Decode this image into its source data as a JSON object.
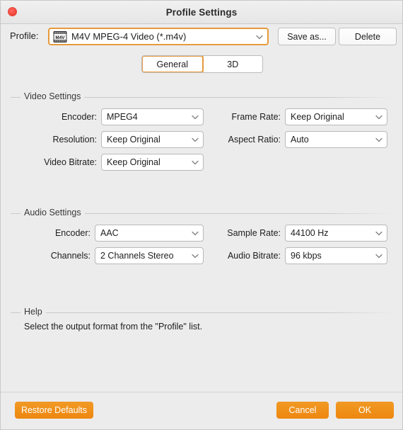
{
  "window": {
    "title": "Profile Settings",
    "close_icon": "close-traffic-light-icon",
    "accent_orange": "#ee8a14",
    "focus_orange": "#e79a3c",
    "background": "#ececec"
  },
  "profile": {
    "label": "Profile:",
    "icon": "m4v-film-strip-icon",
    "icon_text": "M4V",
    "value": "M4V MPEG-4 Video (*.m4v)",
    "chevron_icon": "chevron-down-icon",
    "save_as_label": "Save as...",
    "delete_label": "Delete"
  },
  "tabs": [
    {
      "label": "General",
      "active": true
    },
    {
      "label": "3D",
      "active": false
    }
  ],
  "video_settings": {
    "caption": "Video Settings",
    "fields": [
      {
        "label": "Encoder:",
        "value": "MPEG4"
      },
      {
        "label": "Resolution:",
        "value": "Keep Original"
      },
      {
        "label": "Video Bitrate:",
        "value": "Keep Original"
      },
      {
        "label": "Frame Rate:",
        "value": "Keep Original"
      },
      {
        "label": "Aspect Ratio:",
        "value": "Auto"
      }
    ]
  },
  "audio_settings": {
    "caption": "Audio Settings",
    "fields": [
      {
        "label": "Encoder:",
        "value": "AAC"
      },
      {
        "label": "Channels:",
        "value": "2 Channels Stereo"
      },
      {
        "label": "Sample Rate:",
        "value": "44100 Hz"
      },
      {
        "label": "Audio Bitrate:",
        "value": "96 kbps"
      }
    ]
  },
  "help": {
    "caption": "Help",
    "text": "Select the output format from the \"Profile\" list."
  },
  "footer": {
    "restore_label": "Restore Defaults",
    "cancel_label": "Cancel",
    "ok_label": "OK"
  }
}
